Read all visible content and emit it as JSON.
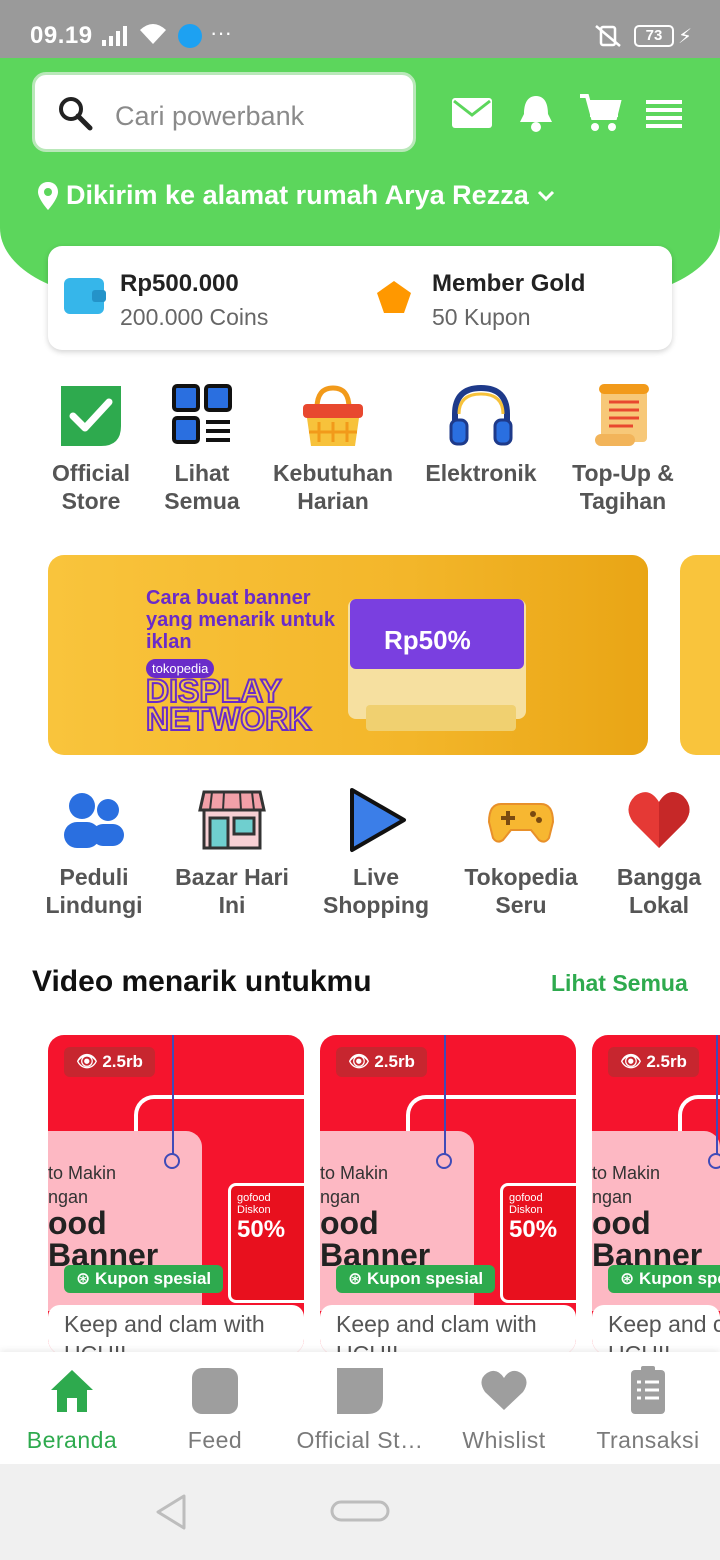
{
  "status_bar": {
    "time": "09.19",
    "battery": "73"
  },
  "search": {
    "placeholder": "Cari powerbank"
  },
  "header": {
    "address": "Dikirim ke alamat rumah Arya Rezza"
  },
  "wallet": {
    "balance": "Rp500.000",
    "coins": "200.000 Coins",
    "member": "Member Gold",
    "coupons": "50 Kupon"
  },
  "categories": [
    {
      "line1": "Official",
      "line2": "Store",
      "icon": "official-store-icon"
    },
    {
      "line1": "Lihat",
      "line2": "Semua",
      "icon": "grid-icon"
    },
    {
      "line1": "Kebutuhan",
      "line2": "Harian",
      "icon": "basket-icon"
    },
    {
      "line1": "Elektronik",
      "line2": "",
      "icon": "headphones-icon"
    },
    {
      "line1": "Top-Up &",
      "line2": "Tagihan",
      "icon": "scroll-icon"
    }
  ],
  "banner": {
    "headline": "Cara buat banner yang menarik untuk iklan",
    "brand": "tokopedia",
    "title1": "DISPLAY",
    "title2": "NETWORK",
    "discount": "Rp50%"
  },
  "shortcuts": [
    {
      "line1": "Peduli",
      "line2": "Lindungi",
      "icon": "people-icon"
    },
    {
      "line1": "Bazar Hari",
      "line2": "Ini",
      "icon": "shop-icon"
    },
    {
      "line1": "Live",
      "line2": "Shopping",
      "icon": "play-icon"
    },
    {
      "line1": "Tokopedia",
      "line2": "Seru",
      "icon": "gamepad-icon"
    },
    {
      "line1": "Bangga",
      "line2": "Lokal",
      "icon": "heart-icon"
    }
  ],
  "videos": {
    "title": "Video menarik untukmu",
    "see_all": "Lihat Semua",
    "items": [
      {
        "views": "2.5rb",
        "coupon": "Kupon spesial",
        "caption": "Keep and clam with",
        "caption2": "UCHIL",
        "promo1": "to Makin",
        "promo2": "ngan",
        "promo3": "ood",
        "promo4": "Banner",
        "go_brand": "gofood",
        "go_text": "Diskon",
        "go_pct": "50%"
      },
      {
        "views": "2.5rb",
        "coupon": "Kupon spesial",
        "caption": "Keep and clam with",
        "caption2": "UCHIL",
        "promo1": "to Makin",
        "promo2": "ngan",
        "promo3": "ood",
        "promo4": "Banner",
        "go_brand": "gofood",
        "go_text": "Diskon",
        "go_pct": "50%"
      },
      {
        "views": "2.5rb",
        "coupon": "Kupon spe",
        "caption": "Keep and c",
        "caption2": "UCHIL",
        "promo1": "to Makin",
        "promo2": "ngan",
        "promo3": "ood",
        "promo4": "Banner",
        "go_brand": "",
        "go_text": "",
        "go_pct": ""
      }
    ]
  },
  "bottom_nav": [
    {
      "label": "Beranda",
      "icon": "home-icon",
      "active": true
    },
    {
      "label": "Feed",
      "icon": "feed-icon",
      "active": false
    },
    {
      "label": "Official St…",
      "icon": "official-store-icon",
      "active": false
    },
    {
      "label": "Whislist",
      "icon": "heart-icon",
      "active": false
    },
    {
      "label": "Transaksi",
      "icon": "receipt-icon",
      "active": false
    }
  ],
  "colors": {
    "brand_green": "#5cd65c",
    "accent_green": "#2eaa4e",
    "promo_red": "#f5142d"
  }
}
